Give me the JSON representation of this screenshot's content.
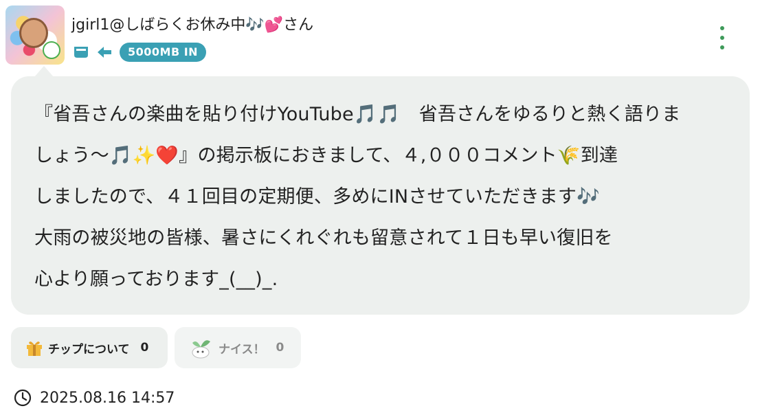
{
  "user": {
    "name": "jgirl1@しばらくお休み中🎶💕さん",
    "badge": "5000MB IN"
  },
  "post": {
    "lines": [
      "『省吾さんの楽曲を貼り付けYouTube🎵🎵　省吾さんをゆるりと熱く語りま",
      "しょう〜🎵✨❤️』の掲示板におきまして、４,０００コメント🌾到達",
      "しましたので、４１回目の定期便、多めにINさせていただきます🎶",
      "大雨の被災地の皆様、暑さにくれぐれも留意されて１日も早い復旧を",
      "心より願っております_(__)_."
    ]
  },
  "actions": {
    "tip_label": "チップについて",
    "tip_count": "0",
    "nice_label": "ナイス！",
    "nice_count": "0"
  },
  "timestamp": "2025.08.16 14:57",
  "colors": {
    "badge_bg": "#3aa0b4",
    "menu_dots": "#3e9a5a",
    "bubble_bg": "#edf0ee"
  },
  "icons": [
    "cup-icon",
    "arrow-left-icon",
    "more-vertical-icon",
    "gift-icon",
    "nice-icon",
    "clock-icon"
  ]
}
